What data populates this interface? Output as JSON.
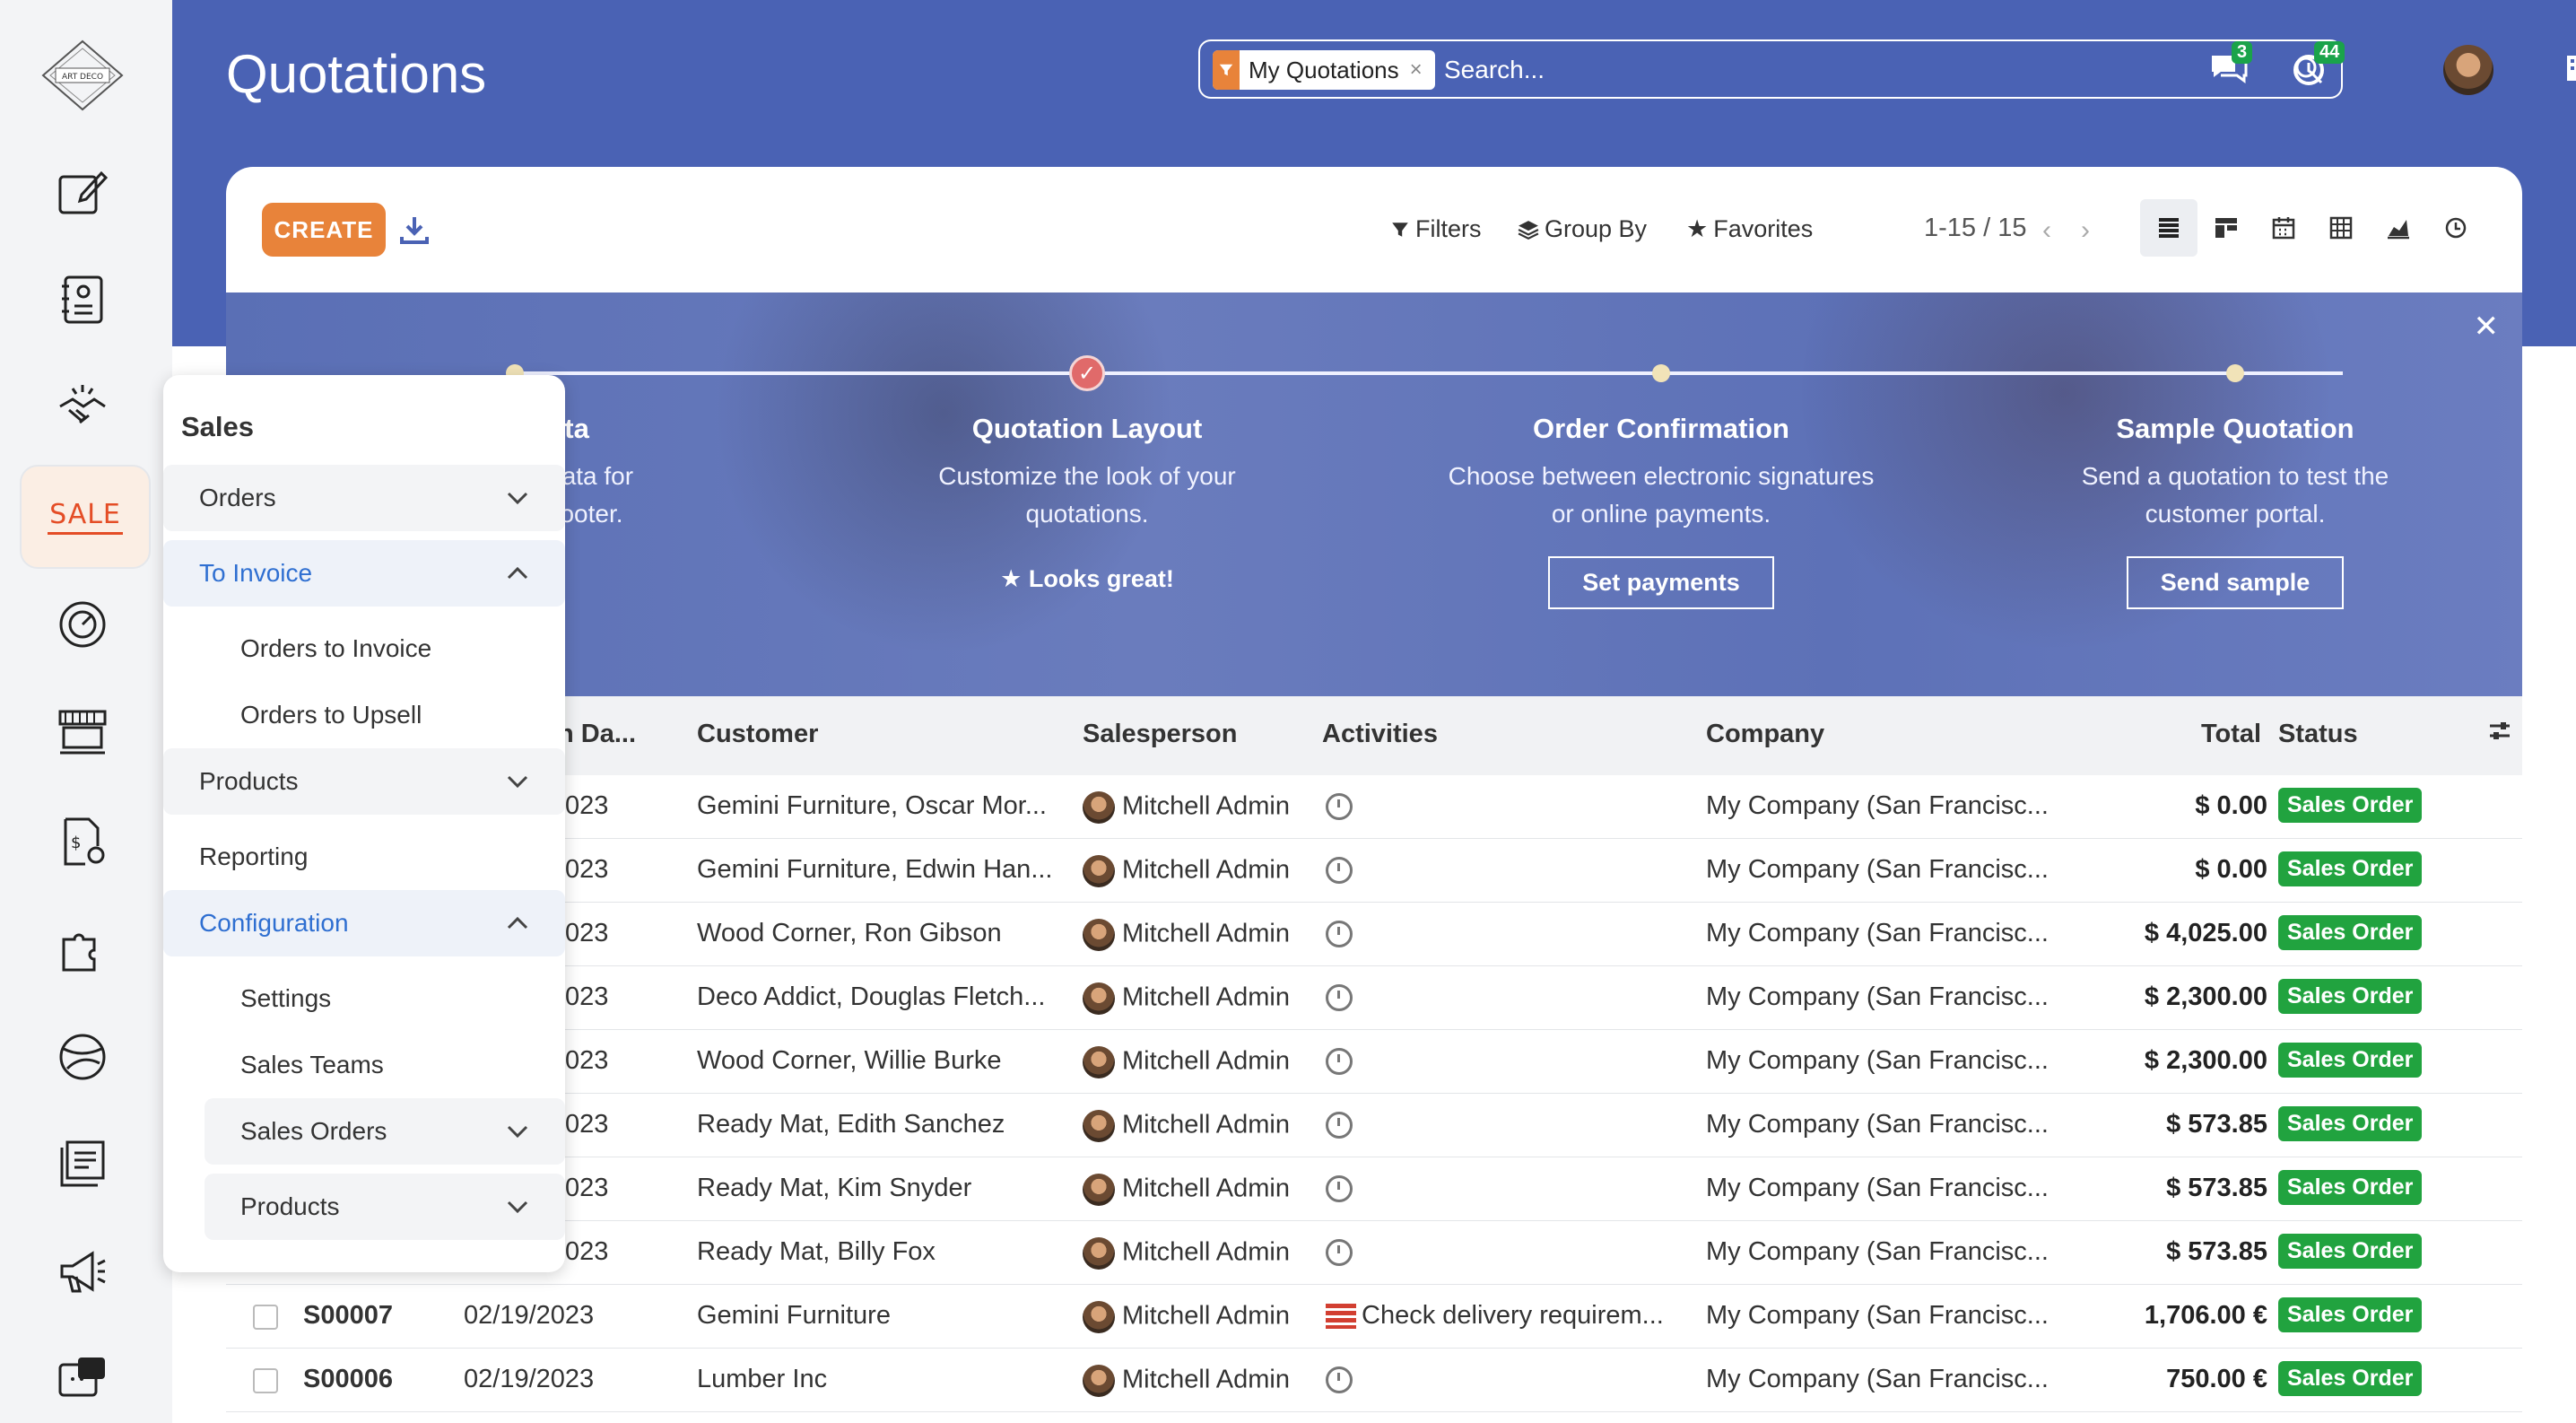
{
  "app": {
    "title": "Quotations"
  },
  "rail": {
    "logo_text": "ART DECO",
    "active_app_label": "SALE",
    "icons": [
      "notes-icon",
      "contacts-icon",
      "crm-handshake-icon",
      "sale-icon",
      "dashboard-gauge-icon",
      "point-of-sale-icon",
      "invoicing-icon",
      "apps-puzzle-icon",
      "website-globe-icon",
      "elearning-icon",
      "marketing-megaphone-icon",
      "helpdesk-icon"
    ]
  },
  "search": {
    "facet_label": "My Quotations",
    "placeholder": "Search..."
  },
  "systray": {
    "messages_count": "3",
    "activities_count": "44"
  },
  "control_panel": {
    "create_label": "CREATE",
    "filters_label": "Filters",
    "groupby_label": "Group By",
    "favorites_label": "Favorites",
    "pager": "1-15 / 15"
  },
  "banner": {
    "steps": [
      {
        "title": "ata",
        "desc": "'s data for\ner/footer.",
        "button": "!"
      },
      {
        "title": "Quotation Layout",
        "desc": "Customize the look of your quotations.",
        "done": "Looks great!"
      },
      {
        "title": "Order Confirmation",
        "desc": "Choose between electronic signatures or online payments.",
        "button": "Set payments"
      },
      {
        "title": "Sample Quotation",
        "desc": "Send a quotation to test the customer portal.",
        "button": "Send sample"
      }
    ]
  },
  "table": {
    "columns": {
      "date": "n Da...",
      "customer": "Customer",
      "salesperson": "Salesperson",
      "activities": "Activities",
      "company": "Company",
      "total": "Total",
      "status": "Status"
    },
    "rows": [
      {
        "number": "",
        "date": "023",
        "customer": "Gemini Furniture, Oscar Mor...",
        "salesperson": "Mitchell Admin",
        "activity": "",
        "company": "My Company (San Francisc...",
        "total": "$ 0.00",
        "status": "Sales Order"
      },
      {
        "number": "",
        "date": "023",
        "customer": "Gemini Furniture, Edwin Han...",
        "salesperson": "Mitchell Admin",
        "activity": "",
        "company": "My Company (San Francisc...",
        "total": "$ 0.00",
        "status": "Sales Order"
      },
      {
        "number": "",
        "date": "023",
        "customer": "Wood Corner, Ron Gibson",
        "salesperson": "Mitchell Admin",
        "activity": "",
        "company": "My Company (San Francisc...",
        "total": "$ 4,025.00",
        "status": "Sales Order"
      },
      {
        "number": "",
        "date": "023",
        "customer": "Deco Addict, Douglas Fletch...",
        "salesperson": "Mitchell Admin",
        "activity": "",
        "company": "My Company (San Francisc...",
        "total": "$ 2,300.00",
        "status": "Sales Order"
      },
      {
        "number": "",
        "date": "023",
        "customer": "Wood Corner, Willie Burke",
        "salesperson": "Mitchell Admin",
        "activity": "",
        "company": "My Company (San Francisc...",
        "total": "$ 2,300.00",
        "status": "Sales Order"
      },
      {
        "number": "",
        "date": "023",
        "customer": "Ready Mat, Edith Sanchez",
        "salesperson": "Mitchell Admin",
        "activity": "",
        "company": "My Company (San Francisc...",
        "total": "$ 573.85",
        "status": "Sales Order"
      },
      {
        "number": "",
        "date": "023",
        "customer": "Ready Mat, Kim Snyder",
        "salesperson": "Mitchell Admin",
        "activity": "",
        "company": "My Company (San Francisc...",
        "total": "$ 573.85",
        "status": "Sales Order"
      },
      {
        "number": "",
        "date": "023",
        "customer": "Ready Mat, Billy Fox",
        "salesperson": "Mitchell Admin",
        "activity": "",
        "company": "My Company (San Francisc...",
        "total": "$ 573.85",
        "status": "Sales Order"
      },
      {
        "number": "S00007",
        "date": "02/19/2023",
        "customer": "Gemini Furniture",
        "salesperson": "Mitchell Admin",
        "activity": "Check delivery requirem...",
        "company": "My Company (San Francisc...",
        "total": "1,706.00 €",
        "status": "Sales Order"
      },
      {
        "number": "S00006",
        "date": "02/19/2023",
        "customer": "Lumber Inc",
        "salesperson": "Mitchell Admin",
        "activity": "",
        "company": "My Company (San Francisc...",
        "total": "750.00 €",
        "status": "Sales Order"
      }
    ]
  },
  "menu": {
    "title": "Sales",
    "orders": "Orders",
    "to_invoice": "To Invoice",
    "orders_to_invoice": "Orders to Invoice",
    "orders_to_upsell": "Orders to Upsell",
    "products": "Products",
    "reporting": "Reporting",
    "configuration": "Configuration",
    "settings": "Settings",
    "sales_teams": "Sales Teams",
    "sales_orders": "Sales Orders",
    "config_products": "Products"
  },
  "colors": {
    "header": "#4a62b4",
    "accent": "#e8833a",
    "status_green": "#21a33f",
    "menu_link": "#2f6fd1"
  }
}
